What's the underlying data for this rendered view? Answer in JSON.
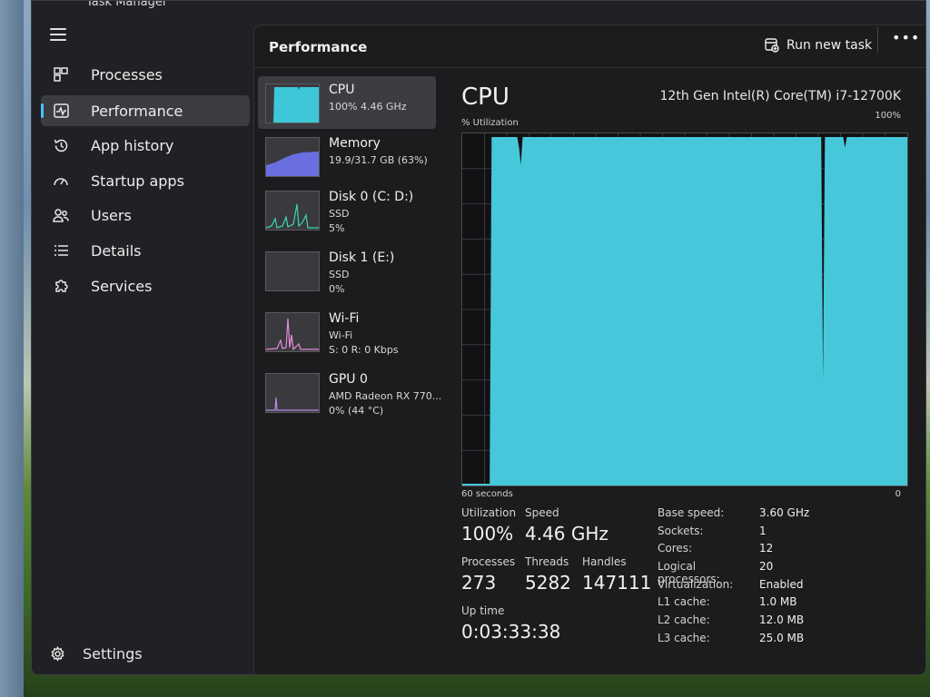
{
  "window": {
    "title": "Task Manager"
  },
  "nav": {
    "items": [
      {
        "label": "Processes",
        "icon": "processes-grid-icon"
      },
      {
        "label": "Performance",
        "icon": "performance-pulse-icon",
        "active": true
      },
      {
        "label": "App history",
        "icon": "history-clock-icon"
      },
      {
        "label": "Startup apps",
        "icon": "startup-gauge-icon"
      },
      {
        "label": "Users",
        "icon": "users-icon"
      },
      {
        "label": "Details",
        "icon": "details-list-icon"
      },
      {
        "label": "Services",
        "icon": "services-puzzle-icon"
      }
    ],
    "settings_label": "Settings"
  },
  "header": {
    "title": "Performance",
    "run_new_task": "Run new task",
    "more": "•••"
  },
  "devices": [
    {
      "name": "CPU",
      "line1": "100%  4.46 GHz",
      "line2": "",
      "color": "#3ec7d9",
      "active": true
    },
    {
      "name": "Memory",
      "line1": "19.9/31.7 GB (63%)",
      "line2": "",
      "color": "#6a6ee0"
    },
    {
      "name": "Disk 0 (C: D:)",
      "line1": "SSD",
      "line2": "5%",
      "color": "#3cd6b4"
    },
    {
      "name": "Disk 1 (E:)",
      "line1": "SSD",
      "line2": "0%",
      "color": "#3cd6b4"
    },
    {
      "name": "Wi-Fi",
      "line1": "Wi-Fi",
      "line2": "S: 0  R: 0 Kbps",
      "color": "#e58ad9"
    },
    {
      "name": "GPU 0",
      "line1": "AMD Radeon RX 770...",
      "line2": "0%  (44 °C)",
      "color": "#b48be8"
    }
  ],
  "detail": {
    "title": "CPU",
    "model": "12th Gen Intel(R) Core(TM) i7-12700K",
    "util_label": "% Utilization",
    "max_label": "100%",
    "time_label": "60 seconds",
    "zero_label": "0",
    "graph_color": "#46c8da",
    "utilization_history_pct": [
      0,
      0,
      0,
      0,
      0,
      0,
      0,
      0,
      0,
      0,
      0,
      0,
      0,
      0,
      0,
      0,
      100,
      100,
      100,
      100,
      100,
      100,
      100,
      100,
      100,
      100,
      100,
      100,
      100,
      100,
      100,
      97,
      92,
      100,
      100,
      100,
      100,
      100,
      100,
      100,
      100,
      100,
      100,
      100,
      100,
      100,
      100,
      100,
      100,
      100,
      100,
      100,
      100,
      100,
      100,
      100,
      100,
      100,
      100,
      100,
      100,
      100,
      100,
      100,
      100,
      100,
      100,
      100,
      100,
      100,
      100,
      100,
      100,
      100,
      100,
      100,
      100,
      100,
      100,
      100,
      100,
      100,
      100,
      100,
      100,
      100,
      100,
      100,
      100,
      100,
      100,
      100,
      100,
      100,
      100,
      100,
      100,
      100,
      100,
      100,
      100,
      100,
      100,
      100,
      100,
      100,
      100,
      100,
      100,
      100,
      100,
      100,
      100,
      100,
      100,
      100,
      100,
      100,
      100,
      100,
      100,
      100,
      100,
      100,
      100,
      100,
      100,
      100,
      100,
      100,
      100,
      100,
      100,
      100,
      100,
      100,
      100,
      100,
      100,
      100,
      100,
      100,
      100,
      100,
      100,
      100,
      100,
      100,
      100,
      100,
      100,
      100,
      100,
      100,
      100,
      100,
      100,
      100,
      100,
      100,
      100,
      100,
      100,
      100,
      100,
      100,
      100,
      100,
      100,
      100,
      100,
      100,
      100,
      100,
      100,
      100,
      100,
      100,
      100,
      100,
      100,
      100,
      100,
      100,
      100,
      100,
      100,
      100,
      100,
      100,
      100,
      100,
      100,
      100,
      100,
      100,
      100,
      30,
      100,
      100,
      100,
      100,
      100,
      100,
      100,
      100,
      100,
      100,
      100,
      97,
      100,
      100,
      100,
      100,
      100,
      100,
      100,
      100,
      100,
      100,
      100,
      100,
      100,
      100,
      100,
      100,
      100,
      100,
      100,
      100,
      100,
      100,
      100,
      100,
      100,
      100,
      100,
      100,
      100,
      100,
      100,
      100,
      100,
      100
    ],
    "stats": {
      "utilization": {
        "label": "Utilization",
        "value": "100%"
      },
      "speed": {
        "label": "Speed",
        "value": "4.46 GHz"
      },
      "processes": {
        "label": "Processes",
        "value": "273"
      },
      "threads": {
        "label": "Threads",
        "value": "5282"
      },
      "handles": {
        "label": "Handles",
        "value": "147111"
      },
      "uptime": {
        "label": "Up time",
        "value": "0:03:33:38"
      }
    },
    "specs": [
      {
        "key": "Base speed:",
        "value": "3.60 GHz"
      },
      {
        "key": "Sockets:",
        "value": "1"
      },
      {
        "key": "Cores:",
        "value": "12"
      },
      {
        "key": "Logical processors:",
        "value": "20"
      },
      {
        "key": "Virtualization:",
        "value": "Enabled"
      },
      {
        "key": "L1 cache:",
        "value": "1.0 MB"
      },
      {
        "key": "L2 cache:",
        "value": "12.0 MB"
      },
      {
        "key": "L3 cache:",
        "value": "25.0 MB"
      }
    ]
  }
}
